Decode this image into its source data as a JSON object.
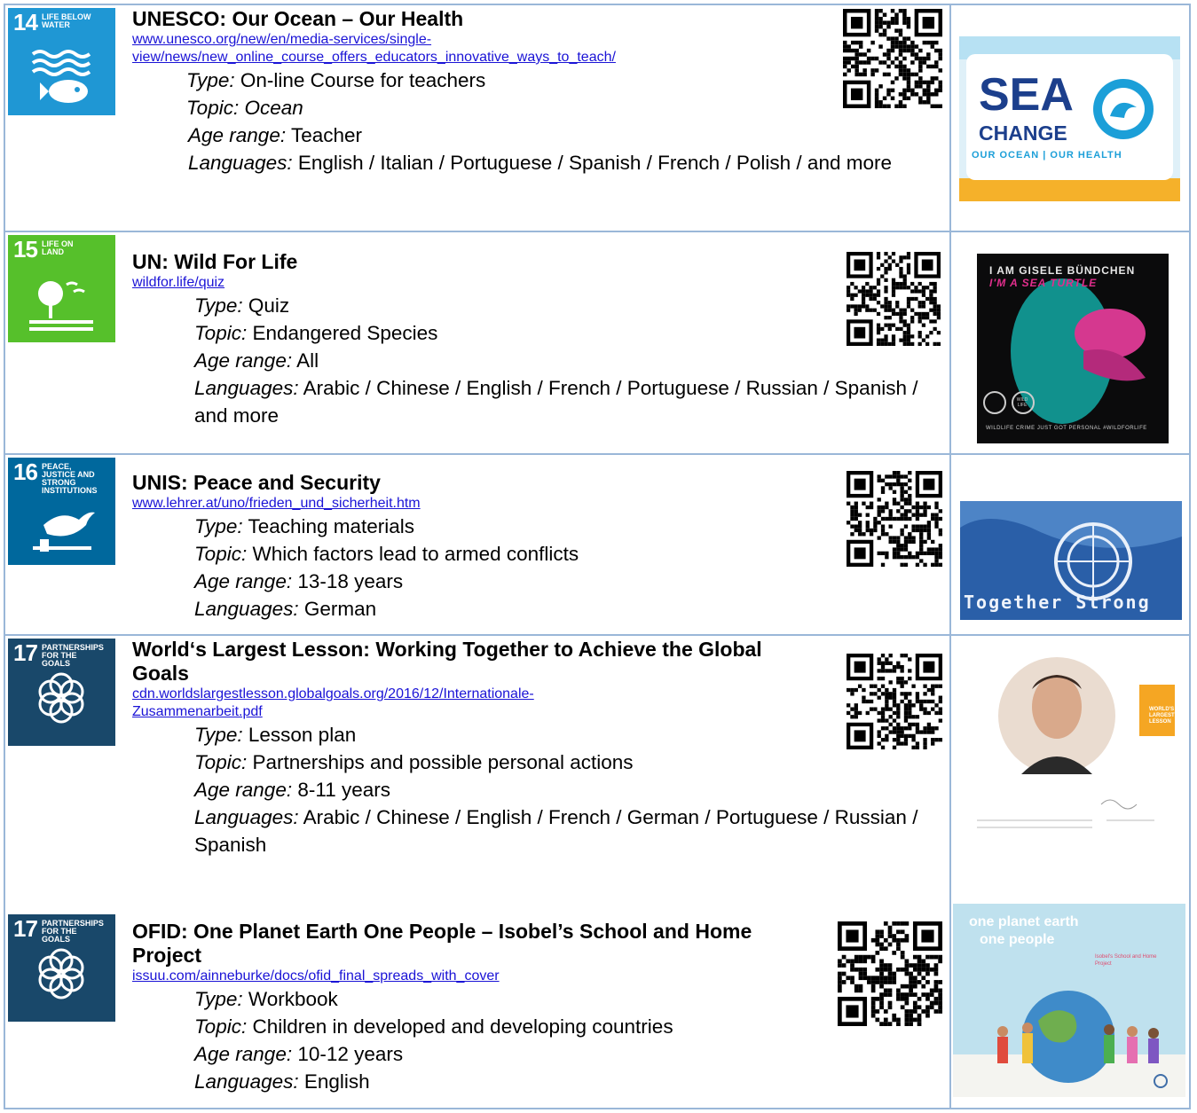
{
  "rows": [
    {
      "sdg": {
        "number": "14",
        "label": "Life below water",
        "color": "#1f97d4"
      },
      "title": "UNESCO: Our Ocean – Our Health",
      "link_line1": "www.unesco.org/new/en/media-services/single-",
      "link_line2": "view/news/new_online_course_offers_educators_innovative_ways_to_teach/",
      "type": "On-line Course for teachers",
      "topic": "Ocean",
      "age": "Teacher",
      "languages": "English / Italian / Portuguese / Spanish / French / Polish / and more",
      "image": {
        "big": "SEA",
        "small": "CHANGE",
        "tag": "OUR OCEAN | OUR HEALTH"
      }
    },
    {
      "sdg": {
        "number": "15",
        "label": "Life on land",
        "color": "#56c02b"
      },
      "title": "UN: Wild For Life",
      "link_line1": "wildfor.life/quiz",
      "type": "Quiz",
      "topic": "Endangered Species",
      "age": "All",
      "languages": "Arabic / Chinese / English / French / Portuguese / Russian / Spanish / and more",
      "image": {
        "line1": "I AM GISELE BÜNDCHEN",
        "line2": "I'M A SEA TURTLE",
        "footer": "WILDLIFE CRIME JUST GOT PERSONAL  #WILDFORLIFE",
        "badge": "WILD LIFE"
      }
    },
    {
      "sdg": {
        "number": "16",
        "label": "Peace, justice and strong institutions",
        "color": "#00689d"
      },
      "title": "UNIS: Peace and Security",
      "link_line1": "www.lehrer.at/uno/frieden_und_sicherheit.htm",
      "type": "Teaching materials",
      "topic": "Which factors lead to armed conflicts",
      "age": "13-18 years",
      "languages": "German",
      "image": {
        "caption": "Together Strong"
      }
    },
    {
      "sdg": {
        "number": "17",
        "label": "Partnerships for the goals",
        "color": "#19486a"
      },
      "title": "World‘s Largest Lesson: Working Together to Achieve the Global Goals",
      "link_line1": "cdn.worldslargestlesson.globalgoals.org/2016/12/Internationale-",
      "link_line2": "Zusammenarbeit.pdf",
      "type": "Lesson plan",
      "topic": "Partnerships and possible personal actions",
      "age": "8-11 years",
      "languages": "Arabic / Chinese / English / French / German / Portuguese / Russian / Spanish",
      "image": {
        "badge": "WORLD'S LARGEST LESSON"
      }
    },
    {
      "sdg": {
        "number": "17",
        "label": "Partnerships for the goals",
        "color": "#19486a"
      },
      "title": "OFID: One Planet Earth One People – Isobel’s School and Home Project",
      "link_line1": "issuu.com/ainneburke/docs/ofid_final_spreads_with_cover",
      "type": "Workbook",
      "topic": "Children in developed and developing countries",
      "age": "10-12 years",
      "languages": "English",
      "image": {
        "line1": "one planet earth",
        "line2": "one people",
        "sub": "Isobel's School and Home Project"
      }
    }
  ],
  "labels": {
    "type": "Type:",
    "topic": "Topic:",
    "age": "Age range:",
    "languages": "Languages:"
  }
}
